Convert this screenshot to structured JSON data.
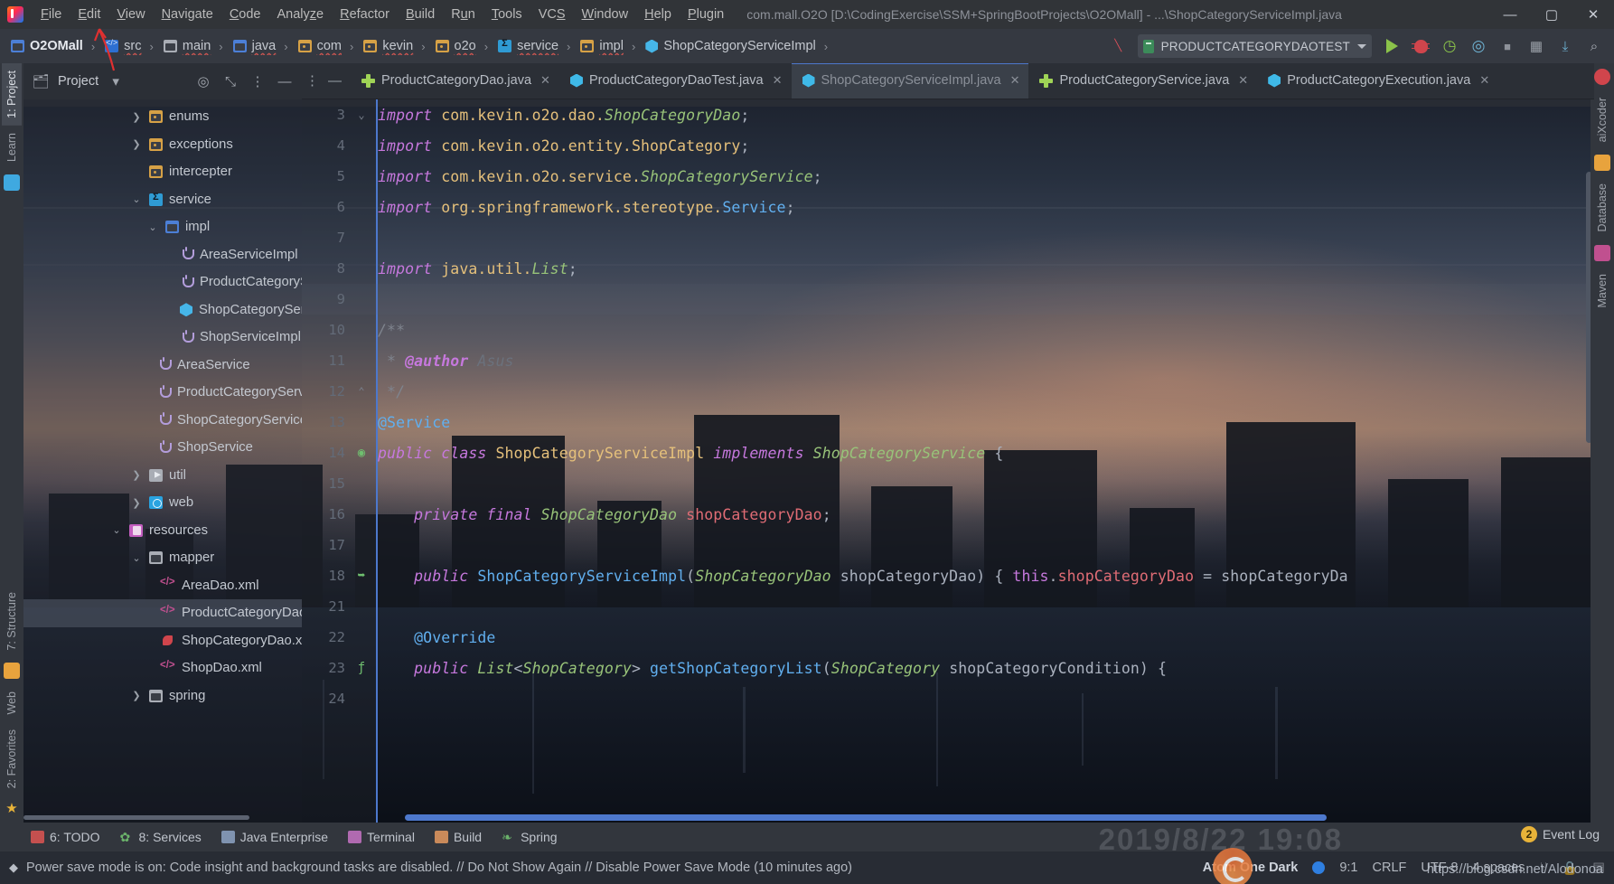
{
  "window": {
    "title": "com.mall.O2O [D:\\CodingExercise\\SSM+SpringBootProjects\\O2OMall] - ...\\ShopCategoryServiceImpl.java",
    "app_icon": "intellij-idea-logo",
    "minimize": "—",
    "maximize": "▢",
    "close": "✕"
  },
  "menu": {
    "items": [
      {
        "label": "File",
        "mnemonic": "F"
      },
      {
        "label": "Edit",
        "mnemonic": "E"
      },
      {
        "label": "View",
        "mnemonic": "V"
      },
      {
        "label": "Navigate",
        "mnemonic": "N"
      },
      {
        "label": "Code",
        "mnemonic": "C"
      },
      {
        "label": "Analyze",
        "mnemonic": "z"
      },
      {
        "label": "Refactor",
        "mnemonic": "R"
      },
      {
        "label": "Build",
        "mnemonic": "B"
      },
      {
        "label": "Run",
        "mnemonic": "u"
      },
      {
        "label": "Tools",
        "mnemonic": "T"
      },
      {
        "label": "VCS",
        "mnemonic": "S"
      },
      {
        "label": "Window",
        "mnemonic": "W"
      },
      {
        "label": "Help",
        "mnemonic": "H"
      },
      {
        "label": "Plugin",
        "mnemonic": "P"
      }
    ]
  },
  "navbar": {
    "crumbs": [
      {
        "label": "O2OMall",
        "icon": "module-icon",
        "error": false
      },
      {
        "label": "src",
        "icon": "source-root-icon",
        "error": true
      },
      {
        "label": "main",
        "icon": "folder-gray-icon",
        "error": true
      },
      {
        "label": "java",
        "icon": "folder-blue-icon",
        "error": true
      },
      {
        "label": "com",
        "icon": "package-icon",
        "error": true
      },
      {
        "label": "kevin",
        "icon": "package-icon",
        "error": true
      },
      {
        "label": "o2o",
        "icon": "package-icon",
        "error": true
      },
      {
        "label": "service",
        "icon": "service-package-icon",
        "error": true
      },
      {
        "label": "impl",
        "icon": "package-icon",
        "error": true
      },
      {
        "label": "ShopCategoryServiceImpl",
        "icon": "java-class-icon",
        "error": false
      }
    ],
    "separator": "›",
    "run_config": {
      "label": "PRODUCTCATEGORYDAOTEST",
      "icon": "run-config-icon",
      "dropdown": "▾"
    },
    "buttons": [
      {
        "name": "build-hammer-icon",
        "glyph": "⟋"
      },
      {
        "name": "run-button",
        "glyph": "▶"
      },
      {
        "name": "debug-button",
        "glyph": "🐞"
      },
      {
        "name": "run-with-coverage-button",
        "glyph": "◷"
      },
      {
        "name": "profile-button",
        "glyph": "◎"
      },
      {
        "name": "stop-button",
        "glyph": "■"
      },
      {
        "name": "apply-changes-button",
        "glyph": "▦"
      },
      {
        "name": "update-project-button",
        "glyph": "⤓"
      },
      {
        "name": "search-everywhere-icon",
        "glyph": "🔍"
      }
    ]
  },
  "tabs": [
    {
      "label": "ProductCategoryDao.java",
      "icon": "interface-icon",
      "active": false,
      "close": "✕"
    },
    {
      "label": "ProductCategoryDaoTest.java",
      "icon": "java-class-icon",
      "active": false,
      "close": "✕"
    },
    {
      "label": "ShopCategoryServiceImpl.java",
      "icon": "java-class-icon",
      "active": true,
      "close": "✕"
    },
    {
      "label": "ProductCategoryService.java",
      "icon": "interface-icon",
      "active": false,
      "close": "✕"
    },
    {
      "label": "ProductCategoryExecution.java",
      "icon": "java-class-icon",
      "active": false,
      "close": "✕"
    }
  ],
  "left_strip": {
    "tabs": [
      {
        "label": "1: Project",
        "selected": true
      },
      {
        "label": "Learn",
        "selected": false
      },
      {
        "label": "7: Structure",
        "selected": false
      },
      {
        "label": "Web",
        "selected": false
      },
      {
        "label": "2: Favorites",
        "selected": false
      }
    ]
  },
  "right_strip": {
    "tabs": [
      {
        "label": "aiXcoder",
        "selected": false
      },
      {
        "label": "Database",
        "selected": false
      },
      {
        "label": "Maven",
        "selected": false
      }
    ]
  },
  "project_panel": {
    "title": "Project",
    "dropdown": "▾",
    "icons": [
      "project-view-icon",
      "locate-icon",
      "collapse-all-icon",
      "options-icon",
      "hide-icon"
    ],
    "tree": [
      {
        "label": "enums",
        "icon": "package-icon",
        "indent": 2,
        "arrow": "collapsed",
        "selected": false
      },
      {
        "label": "exceptions",
        "icon": "package-icon",
        "indent": 2,
        "arrow": "collapsed",
        "selected": false
      },
      {
        "label": "intercepter",
        "icon": "package-icon",
        "indent": 2,
        "arrow": "none",
        "selected": false
      },
      {
        "label": "service",
        "icon": "service-package-icon",
        "indent": 2,
        "arrow": "expanded",
        "selected": false
      },
      {
        "label": "impl",
        "icon": "folder-blue-icon",
        "indent": 3,
        "arrow": "expanded",
        "selected": false
      },
      {
        "label": "AreaServiceImpl",
        "icon": "java-file-icon",
        "indent": 4,
        "arrow": "none",
        "selected": false
      },
      {
        "label": "ProductCategoryServiceImpl",
        "icon": "java-file-icon",
        "indent": 4,
        "arrow": "none",
        "selected": false
      },
      {
        "label": "ShopCategoryServiceImpl",
        "icon": "java-class-icon",
        "indent": 4,
        "arrow": "none",
        "selected": false
      },
      {
        "label": "ShopServiceImpl",
        "icon": "java-file-icon",
        "indent": 4,
        "arrow": "none",
        "selected": false
      },
      {
        "label": "AreaService",
        "icon": "java-file-icon",
        "indent": 3,
        "arrow": "none",
        "selected": false
      },
      {
        "label": "ProductCategoryService",
        "icon": "java-file-icon",
        "indent": 3,
        "arrow": "none",
        "selected": false
      },
      {
        "label": "ShopCategoryService",
        "icon": "java-file-icon",
        "indent": 3,
        "arrow": "none",
        "selected": false
      },
      {
        "label": "ShopService",
        "icon": "java-file-icon",
        "indent": 3,
        "arrow": "none",
        "selected": false
      },
      {
        "label": "util",
        "icon": "util-folder-icon",
        "indent": 2,
        "arrow": "collapsed",
        "selected": false
      },
      {
        "label": "web",
        "icon": "web-folder-icon",
        "indent": 2,
        "arrow": "collapsed",
        "selected": false
      },
      {
        "label": "resources",
        "icon": "resources-folder-icon",
        "indent": 1,
        "arrow": "expanded",
        "selected": false
      },
      {
        "label": "mapper",
        "icon": "folder-gray-icon",
        "indent": 2,
        "arrow": "expanded",
        "selected": false
      },
      {
        "label": "AreaDao.xml",
        "icon": "xml-file-icon",
        "indent": 3,
        "arrow": "none",
        "selected": false
      },
      {
        "label": "ProductCategoryDao.xml",
        "icon": "xml-file-icon",
        "indent": 3,
        "arrow": "none",
        "selected": true
      },
      {
        "label": "ShopCategoryDao.xml",
        "icon": "spring-xml-file-icon",
        "indent": 3,
        "arrow": "none",
        "selected": false
      },
      {
        "label": "ShopDao.xml",
        "icon": "xml-file-icon",
        "indent": 3,
        "arrow": "none",
        "selected": false
      },
      {
        "label": "spring",
        "icon": "folder-gray-icon",
        "indent": 2,
        "arrow": "collapsed",
        "selected": false
      }
    ]
  },
  "editor": {
    "file": "ShopCategoryServiceImpl.java",
    "lines": [
      {
        "no": "3",
        "gutter": "fold-collapse",
        "tokens": [
          {
            "t": "import ",
            "c": "kw"
          },
          {
            "t": "com.kevin.o2o.dao.",
            "c": "pkg"
          },
          {
            "t": "ShopCategoryDao",
            "c": "clsi"
          },
          {
            "t": ";",
            "c": "pn"
          }
        ]
      },
      {
        "no": "4",
        "gutter": "",
        "tokens": [
          {
            "t": "import ",
            "c": "kw"
          },
          {
            "t": "com.kevin.o2o.entity.ShopCategory",
            "c": "pkg"
          },
          {
            "t": ";",
            "c": "pn"
          }
        ]
      },
      {
        "no": "5",
        "gutter": "",
        "tokens": [
          {
            "t": "import ",
            "c": "kw"
          },
          {
            "t": "com.kevin.o2o.service.",
            "c": "pkg"
          },
          {
            "t": "ShopCategoryService",
            "c": "clsi"
          },
          {
            "t": ";",
            "c": "pn"
          }
        ]
      },
      {
        "no": "6",
        "gutter": "",
        "tokens": [
          {
            "t": "import ",
            "c": "kw"
          },
          {
            "t": "org.springframework.stereotype.",
            "c": "pkg"
          },
          {
            "t": "Service",
            "c": "fn"
          },
          {
            "t": ";",
            "c": "pn"
          }
        ]
      },
      {
        "no": "7",
        "gutter": "",
        "tokens": []
      },
      {
        "no": "8",
        "gutter": "",
        "tokens": [
          {
            "t": "import ",
            "c": "kw"
          },
          {
            "t": "java.util.",
            "c": "pkg"
          },
          {
            "t": "List",
            "c": "clsi"
          },
          {
            "t": ";",
            "c": "pn"
          }
        ]
      },
      {
        "no": "9",
        "gutter": "",
        "tokens": []
      },
      {
        "no": "10",
        "gutter": "",
        "tokens": [
          {
            "t": "/**",
            "c": "cmt"
          }
        ]
      },
      {
        "no": "11",
        "gutter": "",
        "tokens": [
          {
            "t": " * ",
            "c": "cmt"
          },
          {
            "t": "@author",
            "c": "cmtb"
          },
          {
            "t": " Asus",
            "c": "cmtv"
          }
        ]
      },
      {
        "no": "12",
        "gutter": "fold-end",
        "tokens": [
          {
            "t": " */",
            "c": "cmt"
          }
        ]
      },
      {
        "no": "13",
        "gutter": "",
        "tokens": [
          {
            "t": "@Service",
            "c": "ann"
          }
        ]
      },
      {
        "no": "14",
        "gutter": "class-marker",
        "tokens": [
          {
            "t": "public ",
            "c": "kw"
          },
          {
            "t": "class ",
            "c": "kw"
          },
          {
            "t": "ShopCategoryServiceImpl",
            "c": "cls"
          },
          {
            "t": " implements ",
            "c": "kw"
          },
          {
            "t": "ShopCategoryService",
            "c": "clsi"
          },
          {
            "t": " {",
            "c": "pn"
          }
        ]
      },
      {
        "no": "15",
        "gutter": "",
        "tokens": []
      },
      {
        "no": "16",
        "gutter": "",
        "tokens": [
          {
            "t": "    private ",
            "c": "kw"
          },
          {
            "t": "final ",
            "c": "kw"
          },
          {
            "t": "ShopCategoryDao",
            "c": "clsi"
          },
          {
            "t": " ",
            "c": "pn"
          },
          {
            "t": "shopCategoryDao",
            "c": "var"
          },
          {
            "t": ";",
            "c": "pn"
          }
        ]
      },
      {
        "no": "17",
        "gutter": "",
        "tokens": []
      },
      {
        "no": "18",
        "gutter": "method-marker",
        "tokens": [
          {
            "t": "    public ",
            "c": "kw"
          },
          {
            "t": "ShopCategoryServiceImpl",
            "c": "fn"
          },
          {
            "t": "(",
            "c": "pn"
          },
          {
            "t": "ShopCategoryDao",
            "c": "clsi"
          },
          {
            "t": " shopCategoryDao",
            "c": "pn"
          },
          {
            "t": ") { ",
            "c": "pn"
          },
          {
            "t": "this",
            "c": "kw2"
          },
          {
            "t": ".",
            "c": "pn"
          },
          {
            "t": "shopCategoryDao",
            "c": "var"
          },
          {
            "t": " = ",
            "c": "pn"
          },
          {
            "t": "shopCategoryDa",
            "c": "pn"
          }
        ]
      },
      {
        "no": "21",
        "gutter": "",
        "tokens": []
      },
      {
        "no": "22",
        "gutter": "",
        "tokens": [
          {
            "t": "    @Override",
            "c": "ann"
          }
        ]
      },
      {
        "no": "23",
        "gutter": "override-marker",
        "tokens": [
          {
            "t": "    public ",
            "c": "kw"
          },
          {
            "t": "List",
            "c": "clsi"
          },
          {
            "t": "<",
            "c": "pn"
          },
          {
            "t": "ShopCategory",
            "c": "clsi"
          },
          {
            "t": "> ",
            "c": "pn"
          },
          {
            "t": "getShopCategoryList",
            "c": "fn"
          },
          {
            "t": "(",
            "c": "pn"
          },
          {
            "t": "ShopCategory",
            "c": "clsi"
          },
          {
            "t": " shopCategoryCondition",
            "c": "pn"
          },
          {
            "t": ") {",
            "c": "pn"
          }
        ]
      },
      {
        "no": "24",
        "gutter": "",
        "tokens": []
      }
    ]
  },
  "bottom_bar": {
    "items": [
      {
        "label": "6: TODO",
        "mnemonic": "6",
        "icon": "todo-icon"
      },
      {
        "label": "8: Services",
        "mnemonic": "8",
        "icon": "services-icon"
      },
      {
        "label": "Java Enterprise",
        "mnemonic": "",
        "icon": "java-enterprise-icon"
      },
      {
        "label": "Terminal",
        "mnemonic": "",
        "icon": "terminal-icon"
      },
      {
        "label": "Build",
        "mnemonic": "",
        "icon": "build-icon"
      },
      {
        "label": "Spring",
        "mnemonic": "",
        "icon": "spring-icon"
      }
    ]
  },
  "status_bar": {
    "message": "Power save mode is on: Code insight and background tasks are disabled. // Do Not Show Again // Disable Power Save Mode (10 minutes ago)",
    "message_icon": "info-diamond-icon",
    "theme": "Atom One Dark",
    "theme_dot_color": "#2f7fe0",
    "caret_position": "9:1",
    "line_separator": "CRLF",
    "encoding": "UTF-8",
    "indent": "4 spaces",
    "event_log": "Event Log",
    "event_count": "2",
    "extra_icons": [
      "git-branch-icon",
      "lock-icon",
      "memory-icon"
    ]
  },
  "watermark": {
    "date": "2019/8/22",
    "time": "19:08",
    "url": "https://blog.csdn.net/Alodonoa"
  },
  "annotation": {
    "arrow_color": "#e03030",
    "points_to": "View menu"
  }
}
